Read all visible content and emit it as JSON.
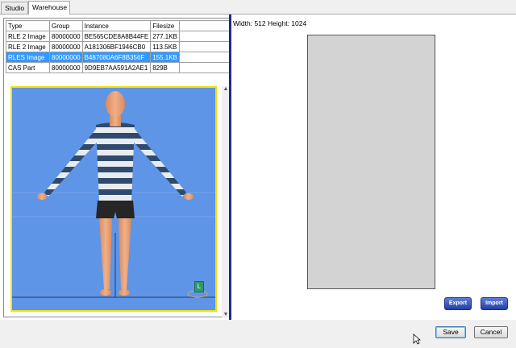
{
  "tabs": [
    {
      "label": "Studio",
      "active": false
    },
    {
      "label": "Warehouse",
      "active": true
    }
  ],
  "table": {
    "headers": [
      "Type",
      "Group",
      "Instance",
      "Filesize"
    ],
    "rows": [
      {
        "type": "RLE 2 Image",
        "group": "80000000",
        "instance": "BE565CDE8A8B44FE",
        "filesize": "277.1KB",
        "selected": false
      },
      {
        "type": "RLE 2 Image",
        "group": "80000000",
        "instance": "A181306BF1946CB0",
        "filesize": "113.5KB",
        "selected": false
      },
      {
        "type": "RLES Image",
        "group": "80000000",
        "instance": "B487080A6F8B356F",
        "filesize": "155.1KB",
        "selected": true
      },
      {
        "type": "CAS Part",
        "group": "80000000",
        "instance": "9D9EB7AA591A2AE1",
        "filesize": "829B",
        "selected": false
      }
    ]
  },
  "preview": {
    "badge": "L",
    "background_color": "#5f95e6",
    "border_color": "#f5e200"
  },
  "image_info": "Width: 512 Height: 1024",
  "buttons": {
    "export": "Export",
    "import": "Import",
    "save": "Save",
    "cancel": "Cancel"
  }
}
